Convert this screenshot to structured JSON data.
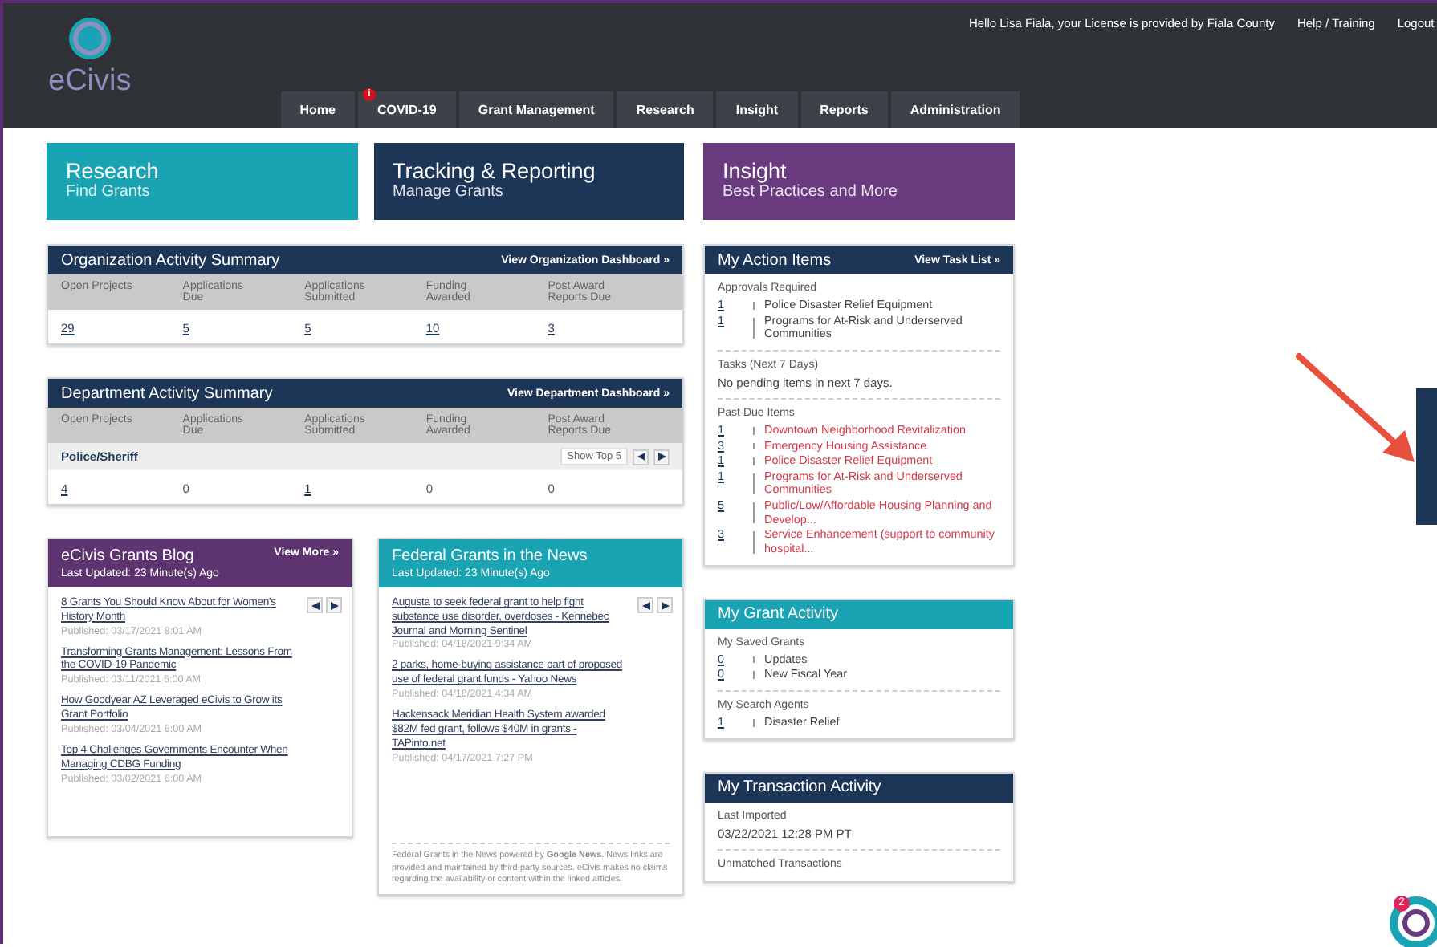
{
  "header": {
    "logo": "eCivis",
    "greeting": "Hello Lisa Fiala, your License is provided by Fiala County",
    "links": [
      "Help / Training",
      "Logout"
    ],
    "nav": [
      {
        "label": "Home",
        "selected": false
      },
      {
        "label": "COVID-19",
        "selected": false,
        "badge": "i"
      },
      {
        "label": "Grant Management",
        "selected": false
      },
      {
        "label": "Research",
        "selected": false
      },
      {
        "label": "Insight",
        "selected": false
      },
      {
        "label": "Reports",
        "selected": false
      },
      {
        "label": "Administration",
        "selected": false
      }
    ]
  },
  "banners": [
    {
      "title": "Research",
      "subtitle": "Find Grants",
      "color": "#1aa3b3"
    },
    {
      "title": "Tracking & Reporting",
      "subtitle": "Manage Grants",
      "color": "#1d3557"
    },
    {
      "title": "Insight",
      "subtitle": "Best Practices and More",
      "color": "#6a3a7e"
    }
  ],
  "org_summary": {
    "title": "Organization Activity Summary",
    "link": "View Organization Dashboard »",
    "columns": [
      "Open Projects",
      "Applications Due",
      "Applications Submitted",
      "Funding Awarded",
      "Post Award Reports Due"
    ],
    "values": [
      {
        "text": "29",
        "link": true
      },
      {
        "text": "5",
        "link": true
      },
      {
        "text": "5",
        "link": true
      },
      {
        "text": "10",
        "link": true
      },
      {
        "text": "3",
        "link": true
      }
    ]
  },
  "dept_summary": {
    "title": "Department Activity Summary",
    "link": "View Department Dashboard »",
    "columns": [
      "Open Projects",
      "Applications Due",
      "Applications Submitted",
      "Funding Awarded",
      "Post Award Reports Due"
    ],
    "department": "Police/Sheriff",
    "show_top": "Show Top 5",
    "values": [
      {
        "text": "4",
        "link": true
      },
      {
        "text": "0",
        "link": false
      },
      {
        "text": "1",
        "link": true
      },
      {
        "text": "0",
        "link": false
      },
      {
        "text": "0",
        "link": false
      }
    ]
  },
  "blog": {
    "title": "eCivis Grants Blog",
    "link": "View More »",
    "updated": "Last Updated: 23 Minute(s) Ago",
    "items": [
      {
        "title": "8 Grants You Should Know About for Women's History Month",
        "published": "Published: 03/17/2021 8:01 AM"
      },
      {
        "title": "Transforming Grants Management: Lessons From the COVID-19 Pandemic",
        "published": "Published: 03/11/2021 6:00 AM"
      },
      {
        "title": "How Goodyear AZ Leveraged eCivis to Grow its Grant Portfolio",
        "published": "Published: 03/04/2021 6:00 AM"
      },
      {
        "title": "Top 4 Challenges Governments Encounter When Managing CDBG Funding",
        "published": "Published: 03/02/2021 6:00 AM"
      }
    ]
  },
  "news": {
    "title": "Federal Grants in the News",
    "updated": "Last Updated: 23 Minute(s) Ago",
    "items": [
      {
        "title": "Augusta to seek federal grant to help fight substance use disorder, overdoses - Kennebec Journal and Morning Sentinel",
        "published": "Published: 04/18/2021 9:34 AM"
      },
      {
        "title": "2 parks, home-buying assistance part of proposed use of federal grant funds - Yahoo News",
        "published": "Published: 04/18/2021 4:34 AM"
      },
      {
        "title": "Hackensack Meridian Health System awarded $82M fed grant, follows $40M in grants - TAPinto.net",
        "published": "Published: 04/17/2021 7:27 PM"
      }
    ],
    "footer": "Federal Grants in the News powered by **Google News**. News links are provided and maintained by third-party sources. eCivis makes no claims regarding the availability or content within the linked articles."
  },
  "action_items": {
    "title": "My Action Items",
    "link": "View Task List »",
    "sections": [
      {
        "heading": "Approvals Required",
        "kind": "list",
        "items": [
          {
            "count": "1",
            "label": "Police Disaster Relief Equipment",
            "overdue": false
          },
          {
            "count": "1",
            "label": "Programs for At-Risk and Underserved Communities",
            "overdue": false
          }
        ]
      },
      {
        "heading": "Tasks (Next 7 Days)",
        "kind": "text",
        "text": "No pending items in next 7 days."
      },
      {
        "heading": "Past Due Items",
        "kind": "list",
        "items": [
          {
            "count": "1",
            "label": "Downtown Neighborhood Revitalization",
            "overdue": true
          },
          {
            "count": "3",
            "label": "Emergency Housing Assistance",
            "overdue": true
          },
          {
            "count": "1",
            "label": "Police Disaster Relief Equipment",
            "overdue": true
          },
          {
            "count": "1",
            "label": "Programs for At-Risk and Underserved Communities",
            "overdue": true
          },
          {
            "count": "5",
            "label": "Public/Low/Affordable Housing Planning and Develop...",
            "overdue": true
          },
          {
            "count": "3",
            "label": "Service Enhancement (support to community hospital...",
            "overdue": true
          }
        ]
      }
    ]
  },
  "grant_activity": {
    "title": "My Grant Activity",
    "sections": [
      {
        "heading": "My Saved Grants",
        "kind": "list",
        "items": [
          {
            "count": "0",
            "label": "Updates",
            "overdue": false
          },
          {
            "count": "0",
            "label": "New Fiscal Year",
            "overdue": false
          }
        ]
      },
      {
        "heading": "My Search Agents",
        "kind": "list",
        "items": [
          {
            "count": "1",
            "label": "Disaster Relief",
            "overdue": false
          }
        ]
      }
    ]
  },
  "transaction_activity": {
    "title": "My Transaction Activity",
    "sections": [
      {
        "heading": "Last Imported",
        "kind": "text",
        "text": "03/22/2021 12:28 PM PT"
      },
      {
        "heading": "Unmatched Transactions",
        "kind": "heading"
      }
    ]
  },
  "chat": {
    "badge": "2"
  }
}
